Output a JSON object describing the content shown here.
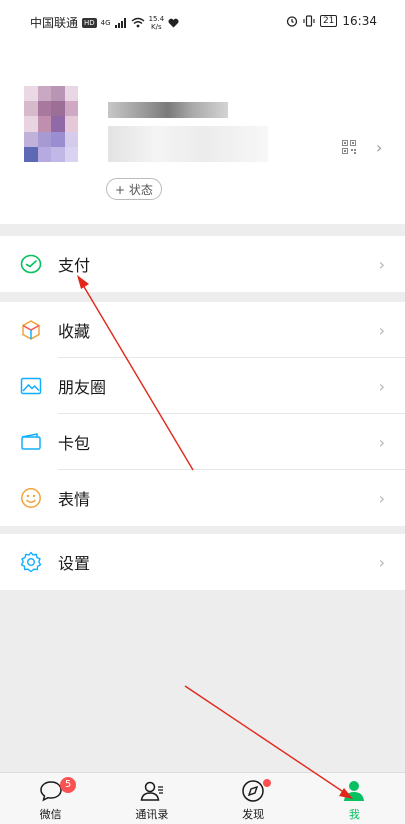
{
  "status_bar": {
    "carrier": "中国联通",
    "hd": "HD",
    "signal": "4G",
    "speed_value": "15.4",
    "speed_unit": "K/s",
    "battery": "21",
    "time": "16:34"
  },
  "profile": {
    "status_button": "+ 状态"
  },
  "menu": {
    "pay": "支付",
    "favorites": "收藏",
    "moments": "朋友圈",
    "cards": "卡包",
    "stickers": "表情",
    "settings": "设置"
  },
  "tabbar": {
    "chats": "微信",
    "chats_badge": "5",
    "contacts": "通讯录",
    "discover": "发现",
    "me": "我"
  },
  "colors": {
    "accent": "#07c160",
    "badge": "#fa5151",
    "annotation_arrow": "#e1271a"
  }
}
